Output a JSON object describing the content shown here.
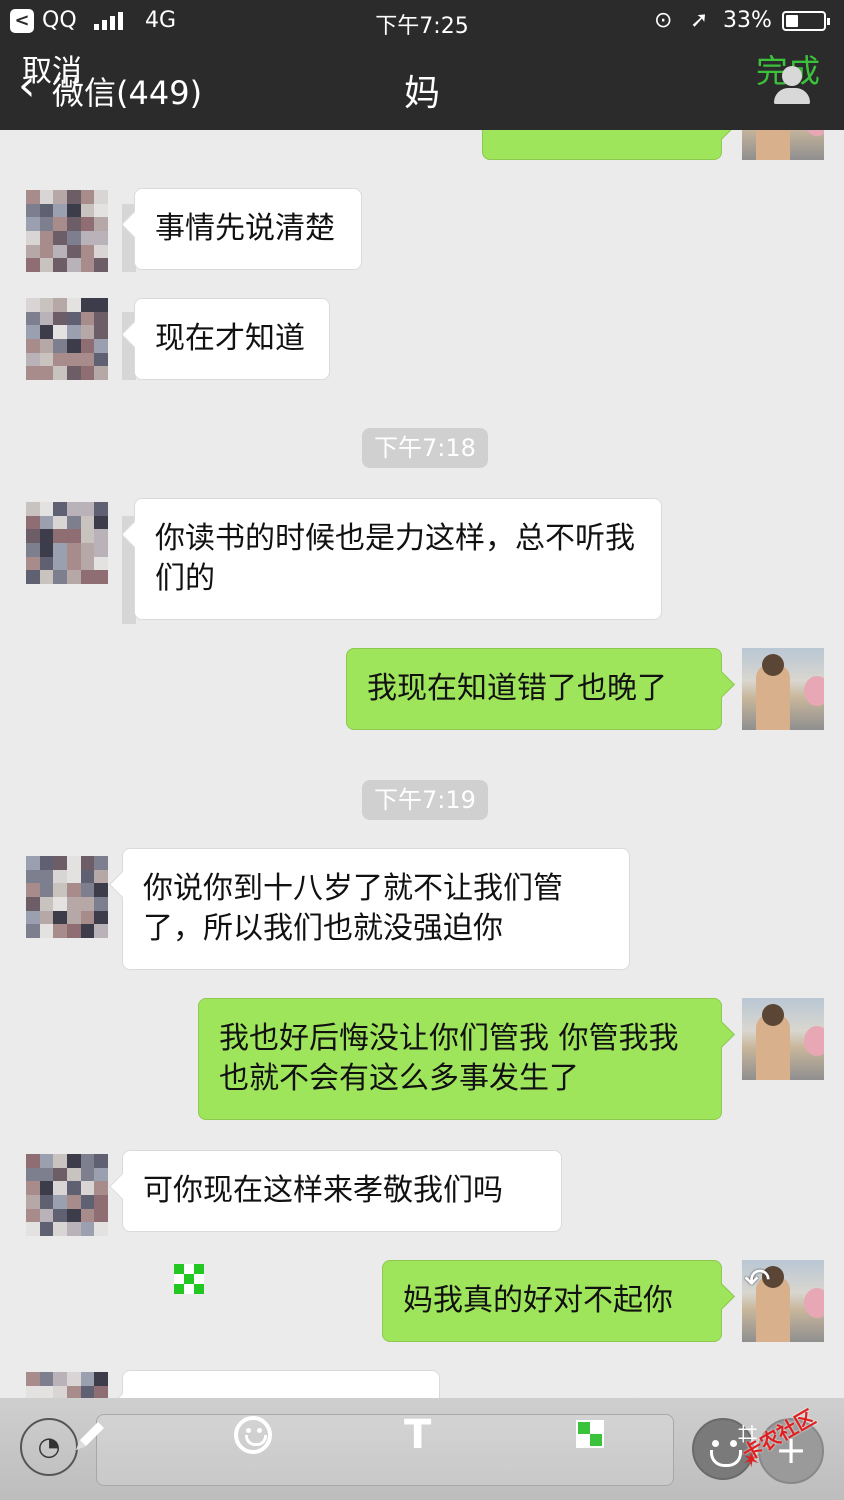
{
  "status_bar": {
    "back_app": "<",
    "carrier": "QQ",
    "network": "4G",
    "time": "下午7:25",
    "battery_percent": "33%",
    "battery_level": 0.33
  },
  "nav": {
    "cancel": "取消",
    "back_label": "微信(449)",
    "title": "妈",
    "done": "完成"
  },
  "messages": [
    {
      "side": "in",
      "text": "事情先说清楚"
    },
    {
      "side": "in",
      "text": "现在才知道"
    },
    {
      "type": "time",
      "text": "下午7:18"
    },
    {
      "side": "in",
      "text": "你读书的时候也是力这样，总不听我们的"
    },
    {
      "side": "out",
      "text": "我现在知道错了也晚了"
    },
    {
      "type": "time",
      "text": "下午7:19"
    },
    {
      "side": "in",
      "text": "你说你到十八岁了就不让我们管了，所以我们也就没强迫你"
    },
    {
      "side": "out",
      "text": "我也好后悔没让你们管我  你管我我也就不会有这么多事发生了"
    },
    {
      "side": "in",
      "text": "可你现在这样来孝敬我们吗"
    },
    {
      "side": "out",
      "text": "妈我真的好对不起你"
    }
  ],
  "toolbar": {
    "text_tool": "T",
    "plus": "+"
  },
  "icons": [
    "back-chevron-icon",
    "contact-icon",
    "pencil-icon",
    "emoji-icon",
    "text-icon",
    "mosaic-icon",
    "crop-icon",
    "undo-icon",
    "voice-icon",
    "smile-icon"
  ],
  "watermark": "卡农社区",
  "colors": {
    "accent_green": "#3bc23b",
    "bubble_out": "#9fe55c",
    "bubble_in": "#ffffff",
    "chat_bg": "#ebebeb",
    "topbar": "#2b2b2b"
  }
}
